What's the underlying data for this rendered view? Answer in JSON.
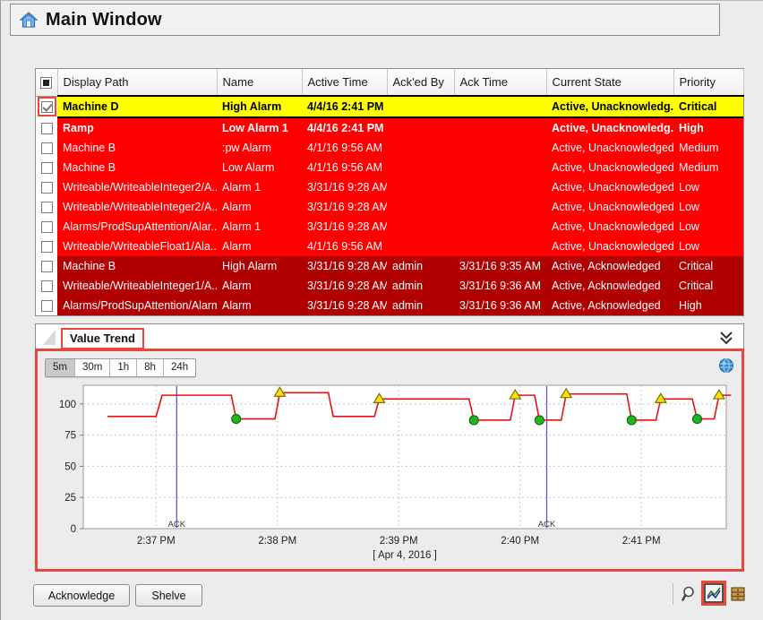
{
  "window": {
    "title": "Main Window",
    "home_icon": "home-icon"
  },
  "alarm_table": {
    "select_all_icon": "select-all-checkbox",
    "columns": [
      "Display Path",
      "Name",
      "Active Time",
      "Ack'ed By",
      "Ack Time",
      "Current State",
      "Priority"
    ],
    "rows": [
      {
        "checked": true,
        "highlight": true,
        "style": "yellow",
        "display_path": "Machine D",
        "name": "High Alarm",
        "active_time": "4/4/16 2:41 PM",
        "acked_by": "",
        "ack_time": "",
        "current_state": "Active, Unacknowledg...",
        "priority": "Critical"
      },
      {
        "checked": false,
        "highlight": false,
        "style": "red-bold",
        "display_path": "Ramp",
        "name": "Low Alarm 1",
        "active_time": "4/4/16 2:41 PM",
        "acked_by": "",
        "ack_time": "",
        "current_state": "Active, Unacknowledg...",
        "priority": "High"
      },
      {
        "checked": false,
        "highlight": false,
        "style": "red",
        "display_path": "Machine B",
        "name": ":pw Alarm",
        "active_time": "4/1/16 9:56 AM",
        "acked_by": "",
        "ack_time": "",
        "current_state": "Active, Unacknowledged",
        "priority": "Medium"
      },
      {
        "checked": false,
        "highlight": false,
        "style": "red",
        "display_path": "Machine B",
        "name": "Low Alarm",
        "active_time": "4/1/16 9:56 AM",
        "acked_by": "",
        "ack_time": "",
        "current_state": "Active, Unacknowledged",
        "priority": "Medium"
      },
      {
        "checked": false,
        "highlight": false,
        "style": "red",
        "display_path": "Writeable/WriteableInteger2/A...",
        "name": "Alarm 1",
        "active_time": "3/31/16 9:28 AM",
        "acked_by": "",
        "ack_time": "",
        "current_state": "Active, Unacknowledged",
        "priority": "Low"
      },
      {
        "checked": false,
        "highlight": false,
        "style": "red",
        "display_path": "Writeable/WriteableInteger2/A...",
        "name": "Alarm",
        "active_time": "3/31/16 9:28 AM",
        "acked_by": "",
        "ack_time": "",
        "current_state": "Active, Unacknowledged",
        "priority": "Low"
      },
      {
        "checked": false,
        "highlight": false,
        "style": "red",
        "display_path": "Alarms/ProdSupAttention/Alar...",
        "name": "Alarm 1",
        "active_time": "3/31/16 9:28 AM",
        "acked_by": "",
        "ack_time": "",
        "current_state": "Active, Unacknowledged",
        "priority": "Low"
      },
      {
        "checked": false,
        "highlight": false,
        "style": "red",
        "display_path": "Writeable/WriteableFloat1/Ala...",
        "name": "Alarm",
        "active_time": "4/1/16 9:56 AM",
        "acked_by": "",
        "ack_time": "",
        "current_state": "Active, Unacknowledged",
        "priority": "Low"
      },
      {
        "checked": false,
        "highlight": false,
        "style": "dark",
        "display_path": "Machine B",
        "name": "High Alarm",
        "active_time": "3/31/16 9:28 AM",
        "acked_by": "admin",
        "ack_time": "3/31/16 9:35 AM",
        "current_state": "Active, Acknowledged",
        "priority": "Critical"
      },
      {
        "checked": false,
        "highlight": false,
        "style": "dark",
        "display_path": "Writeable/WriteableInteger1/A...",
        "name": "Alarm",
        "active_time": "3/31/16 9:28 AM",
        "acked_by": "admin",
        "ack_time": "3/31/16 9:36 AM",
        "current_state": "Active, Acknowledged",
        "priority": "Critical"
      },
      {
        "checked": false,
        "highlight": false,
        "style": "dark",
        "display_path": "Alarms/ProdSupAttention/Alarm",
        "name": "Alarm",
        "active_time": "3/31/16 9:28 AM",
        "acked_by": "admin",
        "ack_time": "3/31/16 9:36 AM",
        "current_state": "Active, Acknowledged",
        "priority": "High"
      }
    ]
  },
  "tabs": {
    "items": [
      {
        "label": "Value Trend",
        "active": true
      }
    ],
    "collapse_icon": "chevron-double-down-icon"
  },
  "trend": {
    "ranges": [
      {
        "label": "5m",
        "active": true
      },
      {
        "label": "30m",
        "active": false
      },
      {
        "label": "1h",
        "active": false
      },
      {
        "label": "8h",
        "active": false
      },
      {
        "label": "24h",
        "active": false
      }
    ],
    "refresh_icon": "globe-refresh-icon",
    "date_label": "[ Apr 4, 2016 ]"
  },
  "chart_data": {
    "type": "line",
    "title": "",
    "xlabel": "[ Apr 4, 2016 ]",
    "ylabel": "",
    "ylim": [
      0,
      115
    ],
    "yticks": [
      0,
      25,
      50,
      75,
      100
    ],
    "xticks": [
      "2:37 PM",
      "2:38 PM",
      "2:39 PM",
      "2:40 PM",
      "2:41 PM"
    ],
    "xlim_minutes": [
      2156.4,
      2161.7
    ],
    "grid": true,
    "legend": "none",
    "line_color": "#e81010",
    "series": [
      {
        "name": "Value",
        "style": "step",
        "points": [
          {
            "t": 2156.6,
            "v": 90
          },
          {
            "t": 2157.0,
            "v": 90
          },
          {
            "t": 2157.05,
            "v": 107
          },
          {
            "t": 2157.62,
            "v": 107
          },
          {
            "t": 2157.66,
            "v": 88
          },
          {
            "t": 2157.98,
            "v": 88
          },
          {
            "t": 2158.02,
            "v": 109
          },
          {
            "t": 2158.42,
            "v": 109
          },
          {
            "t": 2158.46,
            "v": 90
          },
          {
            "t": 2158.8,
            "v": 90
          },
          {
            "t": 2158.84,
            "v": 104
          },
          {
            "t": 2159.58,
            "v": 104
          },
          {
            "t": 2159.62,
            "v": 87
          },
          {
            "t": 2159.92,
            "v": 87
          },
          {
            "t": 2159.96,
            "v": 107
          },
          {
            "t": 2160.12,
            "v": 107
          },
          {
            "t": 2160.16,
            "v": 87
          },
          {
            "t": 2160.34,
            "v": 87
          },
          {
            "t": 2160.38,
            "v": 108
          },
          {
            "t": 2160.88,
            "v": 108
          },
          {
            "t": 2160.92,
            "v": 87
          },
          {
            "t": 2161.12,
            "v": 87
          },
          {
            "t": 2161.16,
            "v": 104
          },
          {
            "t": 2161.42,
            "v": 104
          },
          {
            "t": 2161.46,
            "v": 88
          },
          {
            "t": 2161.6,
            "v": 88
          },
          {
            "t": 2161.64,
            "v": 107
          },
          {
            "t": 2161.74,
            "v": 107
          }
        ]
      }
    ],
    "markers": [
      {
        "type": "alarm-high",
        "shape": "triangle",
        "color": "#ffe100",
        "t": 2158.02,
        "v": 109
      },
      {
        "type": "alarm-clear",
        "shape": "circle",
        "color": "#22b422",
        "t": 2157.66,
        "v": 88
      },
      {
        "type": "alarm-high",
        "shape": "triangle",
        "color": "#ffe100",
        "t": 2158.84,
        "v": 104
      },
      {
        "type": "alarm-clear",
        "shape": "circle",
        "color": "#22b422",
        "t": 2159.62,
        "v": 87
      },
      {
        "type": "alarm-high",
        "shape": "triangle",
        "color": "#ffe100",
        "t": 2159.96,
        "v": 107
      },
      {
        "type": "alarm-clear",
        "shape": "circle",
        "color": "#22b422",
        "t": 2160.16,
        "v": 87
      },
      {
        "type": "alarm-high",
        "shape": "triangle",
        "color": "#ffe100",
        "t": 2160.38,
        "v": 108
      },
      {
        "type": "alarm-clear",
        "shape": "circle",
        "color": "#22b422",
        "t": 2160.92,
        "v": 87
      },
      {
        "type": "alarm-high",
        "shape": "triangle",
        "color": "#ffe100",
        "t": 2161.16,
        "v": 104
      },
      {
        "type": "alarm-clear",
        "shape": "circle",
        "color": "#22b422",
        "t": 2161.46,
        "v": 88
      },
      {
        "type": "alarm-high",
        "shape": "triangle",
        "color": "#ffe100",
        "t": 2161.64,
        "v": 107
      }
    ],
    "event_markers": [
      {
        "label": "ACK",
        "t": 2157.17,
        "color": "#5a5ac8"
      },
      {
        "label": "ACK",
        "t": 2160.22,
        "color": "#5a5ac8"
      }
    ]
  },
  "footer": {
    "acknowledge_label": "Acknowledge",
    "shelve_label": "Shelve",
    "tools": [
      {
        "icon": "magnifier-icon",
        "highlighted": false
      },
      {
        "icon": "chart-icon",
        "highlighted": true
      },
      {
        "icon": "database-icon",
        "highlighted": false
      }
    ]
  },
  "colors": {
    "alarm_unack_selected": "#ffff00",
    "alarm_unack": "#fe0000",
    "alarm_ack": "#b00000",
    "highlight_box": "#e8483c",
    "trend_line": "#e81010"
  }
}
